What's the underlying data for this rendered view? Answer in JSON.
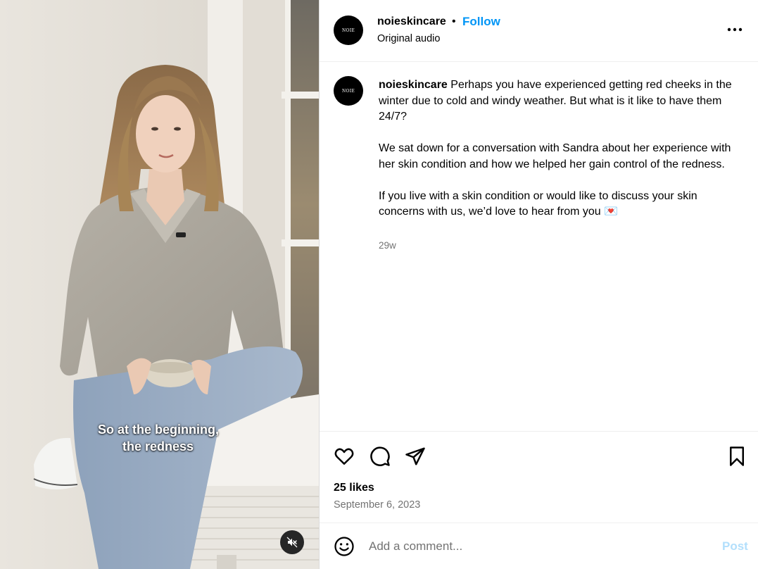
{
  "post": {
    "username": "noieskincare",
    "avatar_text": "NOIE",
    "follow_label": "Follow",
    "separator": "•",
    "audio": "Original audio",
    "caption": {
      "username": "noieskincare",
      "paragraph_1": "Perhaps you have experienced getting red cheeks in the winter due to cold and windy weather. But what is it like to have them 24/7?",
      "paragraph_2": "We sat down for a conversation with Sandra about her experience with her skin condition and how we helped her gain control of the redness.",
      "paragraph_3": "If you live with a skin condition or would like to discuss your skin concerns with us, we’d love to hear from you 💌",
      "age": "29w"
    },
    "likes": "25 likes",
    "date": "September 6, 2023"
  },
  "video": {
    "subtitle_line_1": "So at the beginning,",
    "subtitle_line_2": "the redness",
    "muted": true
  },
  "comment": {
    "placeholder": "Add a comment...",
    "post_label": "Post"
  },
  "icons": {
    "more": "more-options-icon",
    "like": "heart-icon",
    "comment": "comment-icon",
    "share": "share-icon",
    "save": "bookmark-icon",
    "emoji": "emoji-icon",
    "mute": "speaker-muted-icon"
  },
  "colors": {
    "follow": "#0095f6",
    "post_disabled": "#b2dffc",
    "secondary_text": "#737373",
    "divider": "#efefef"
  }
}
